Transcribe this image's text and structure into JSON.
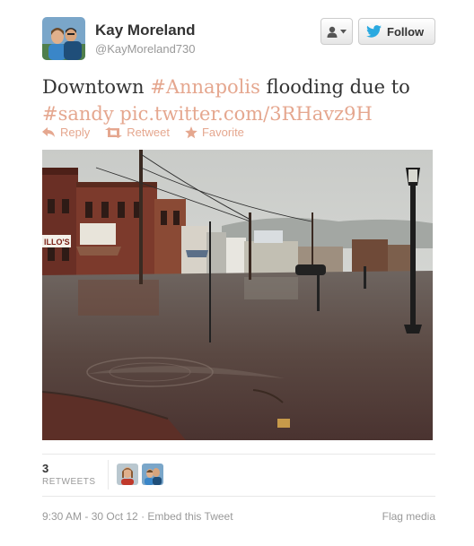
{
  "user": {
    "display_name": "Kay Moreland",
    "screen_name": "@KayMoreland730",
    "avatar_icon": "profile-photo"
  },
  "header": {
    "user_dropdown_icon": "person-with-caret",
    "follow_label": "Follow",
    "follow_icon": "twitter-bird"
  },
  "tweet": {
    "text_prefix": "Downtown ",
    "hashtag_1": "#Annapolis",
    "text_middle": " flooding due to",
    "hashtag_2": "#sandy",
    "link": "pic.twitter.com/3RHavz9H"
  },
  "actions": {
    "reply": "Reply",
    "retweet": "Retweet",
    "favorite": "Favorite"
  },
  "photo": {
    "shop_sign": "ILLO'S",
    "description_icon": "flooded-street-photo"
  },
  "stats": {
    "retweet_count": "3",
    "retweet_label": "RETWEETS"
  },
  "footer": {
    "timestamp": "9:30 AM - 30 Oct 12",
    "separator": " · ",
    "embed": "Embed this Tweet",
    "flag": "Flag media"
  },
  "colors": {
    "link": "#e5a78f",
    "text": "#333333",
    "muted": "#999999",
    "twitter_blue": "#2aa9e0"
  }
}
